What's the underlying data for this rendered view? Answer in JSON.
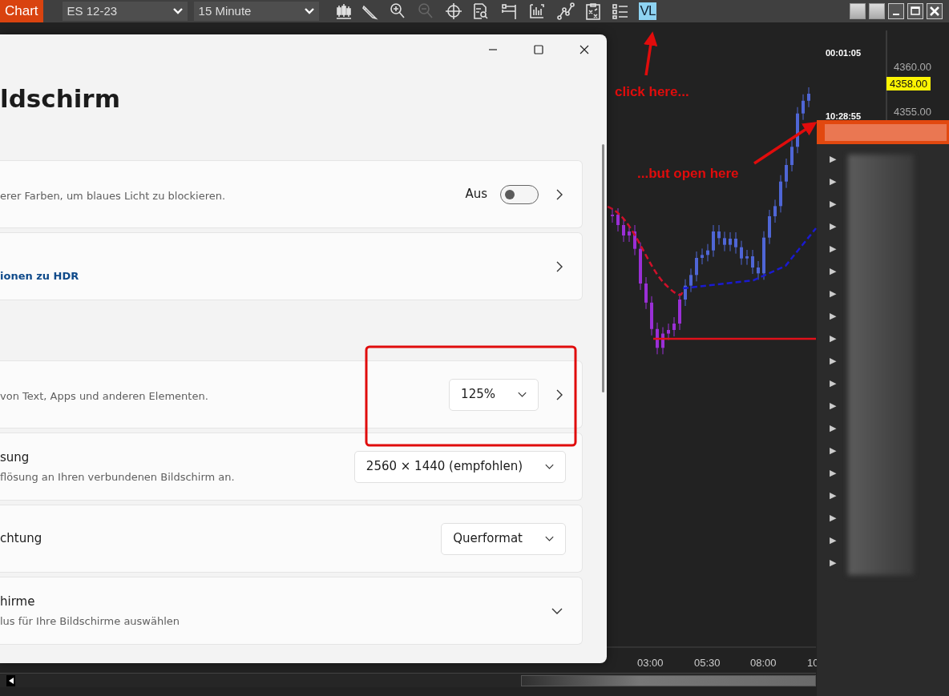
{
  "toolbar": {
    "app_button": "Chart",
    "instrument": "ES 12-23",
    "interval": "15 Minute",
    "tools": [
      {
        "kind": "candles",
        "disabled": false
      },
      {
        "kind": "pencil",
        "disabled": false
      },
      {
        "kind": "zoom_in",
        "disabled": false
      },
      {
        "kind": "zoom_out",
        "disabled": true
      },
      {
        "kind": "crosshair",
        "disabled": false
      },
      {
        "kind": "doc_search",
        "disabled": false
      },
      {
        "kind": "ruler",
        "disabled": false
      },
      {
        "kind": "bars",
        "disabled": false
      },
      {
        "kind": "line",
        "disabled": false
      },
      {
        "kind": "clipboard",
        "disabled": false
      },
      {
        "kind": "list",
        "disabled": false
      }
    ],
    "vl_button": {
      "label": "VL",
      "selected": true
    }
  },
  "chart": {
    "timer": "00:01:05",
    "bar_time": "10:28:55",
    "price_ticks": [
      "4360.00",
      "4355.00"
    ],
    "last_price": "4358.00",
    "time_labels": [
      "03:00",
      "05:30",
      "08:00",
      "10"
    ]
  },
  "settings_window": {
    "heading": "ldschirm",
    "rows": [
      {
        "kind": "toggle",
        "description": "erer Farben, um blaues Licht zu blockieren.",
        "state_label": "Aus",
        "on": false,
        "chevron": true,
        "gap_before": false
      },
      {
        "kind": "link",
        "link": "ionen zu HDR",
        "chevron": true,
        "gap_before": false
      },
      {
        "kind": "dropdown",
        "description": "von Text, Apps und anderen Elementen.",
        "value": "125%",
        "chevron": true,
        "gap_before": true
      },
      {
        "kind": "dropdown",
        "title": "sung",
        "description": "flösung an Ihren verbundenen Bildschirm an.",
        "value": "2560 × 1440 (empfohlen)",
        "chevron": false,
        "gap_before": false
      },
      {
        "kind": "dropdown",
        "title": "chtung",
        "value": "Querformat",
        "chevron": false,
        "gap_before": false
      },
      {
        "kind": "expander",
        "title": "hirme",
        "description": "lus für Ihre Bildschirme auswählen",
        "expanded": false,
        "chevron": false,
        "gap_before": false
      }
    ]
  },
  "annotations": [
    {
      "kind": "highlight"
    },
    {
      "kind": "callout",
      "text": "click here..."
    },
    {
      "kind": "callout",
      "text": "...but open here"
    }
  ],
  "popup_menu": {
    "arrows": [
      "▶",
      "▶",
      "▶",
      "▶",
      "▶",
      "▶",
      "▶",
      "▶",
      "▶",
      "▶",
      "▶",
      "▶",
      "▶",
      "▶",
      "▶",
      "▶",
      "▶",
      "▶",
      "▶"
    ]
  }
}
